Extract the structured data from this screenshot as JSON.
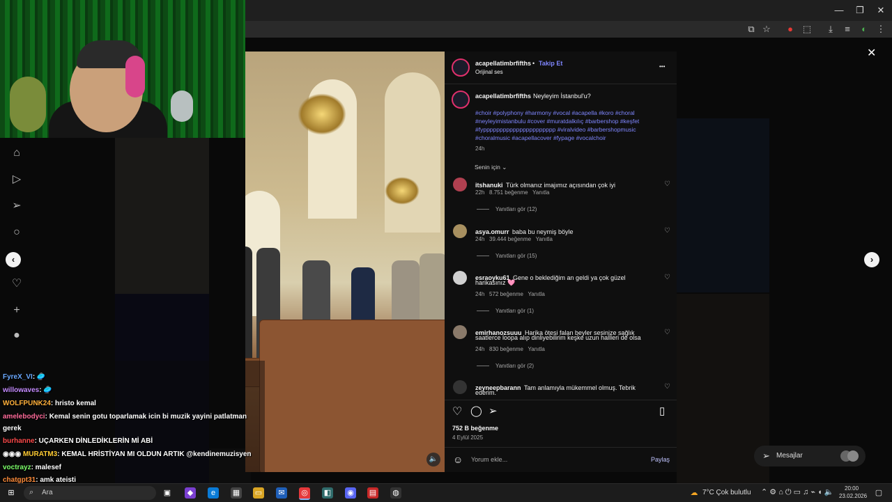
{
  "browser": {
    "close_overlay": "✕"
  },
  "post": {
    "author": "acapellatimbrfifths",
    "separator": "•",
    "follow_label": "Takip Et",
    "audio_label": "Orijinal ses",
    "more_label": "•••",
    "caption_user": "acapellatimbrfifths",
    "caption_text": "Neyleyim İstanbul'u?",
    "hashtags_line1": "#choir #polyphony #harmony #vocal #acapella #koro #choral",
    "hashtags_line2": "#neyleyimistanbulu #cover #muratdalkılıç #barbershop #keşfet",
    "hashtags_line3": "#fypppppppppppppppppppppp #viralvideo #barbershopmusic",
    "hashtags_line4": "#choralmusic #acapellacover #fypage #vocalchoir",
    "caption_time": "24h",
    "sort_label": "Senin için",
    "likes": "752 B beğenme",
    "date": "4 Eylül 2025",
    "comment_placeholder": "Yorum ekle...",
    "share_label": "Paylaş"
  },
  "comments": [
    {
      "user": "itshanuki",
      "text": "Türk olmanız imajımız açısından çok iyi",
      "time": "22h",
      "likes": "8.751 beğenme",
      "reply": "Yanıtla",
      "view_replies": "Yanıtları gör (12)"
    },
    {
      "user": "asya.omurr",
      "text": "baba bu neymiş böyle",
      "time": "24h",
      "likes": "39.444 beğenme",
      "reply": "Yanıtla",
      "view_replies": "Yanıtları gör (15)"
    },
    {
      "user": "esraoyku61",
      "text": "Gene o beklediğim an geldi ya çok güzel",
      "text2": "harikasınız 🩷",
      "time": "24h",
      "likes": "572 beğenme",
      "reply": "Yanıtla",
      "view_replies": "Yanıtları gör (1)"
    },
    {
      "user": "emirhanozsuuu",
      "text": "Harika ötesi falan beyler sesinize sağlık",
      "text2": "saatlerce loopa alıp dinliyebilirim keşke uzun hallleri de olsa",
      "time": "24h",
      "likes": "830 beğenme",
      "reply": "Yanıtla",
      "view_replies": "Yanıtları gör (2)"
    },
    {
      "user": "zeyneepbarann",
      "text": "Tam anlamıyla mükemmel olmuş. Tebrik",
      "text2": "ederim."
    }
  ],
  "messages": {
    "label": "Mesajlar"
  },
  "chat": [
    {
      "user": "FyreX_VI",
      "msg": ": 🥏",
      "color": "#6aa9ff"
    },
    {
      "user": "willowaves",
      "msg": ": 🥏",
      "color": "#c58cff"
    },
    {
      "user": "WOLFPUNK24",
      "msg": ": hristo kemal",
      "color": "#ffb03a"
    },
    {
      "user": "amelebodyci",
      "msg": ": Kemal senin gotu toparlamak icin bi muzik yayini patlatman",
      "color": "#ff6b9a"
    },
    {
      "user": "",
      "msg": "gerek",
      "color": "#ffffff"
    },
    {
      "user": "burhanne",
      "msg": ": UÇARKEN DİNLEDİKLERİN Mİ ABİ",
      "color": "#ff4a4a"
    },
    {
      "user": "MURATM3",
      "msg": ": KEMAL HRİSTİYAN MI OLDUN ARTIK @kendinemuzisyen",
      "color": "#ffcc33"
    },
    {
      "user": "voctrayz",
      "msg": ": malesef",
      "color": "#7dff6a"
    },
    {
      "user": "chatgpt31",
      "msg": ": amk ateisti",
      "color": "#ff8c3a"
    }
  ],
  "taskbar": {
    "search_label": "Ara",
    "weather": "7°C  Çok bulutlu",
    "time": "20:00",
    "date": "23.02.2026"
  },
  "colors": {
    "accent": "#8a8cff",
    "link": "#7f86ff",
    "instagram_ring": "#e1306c"
  }
}
